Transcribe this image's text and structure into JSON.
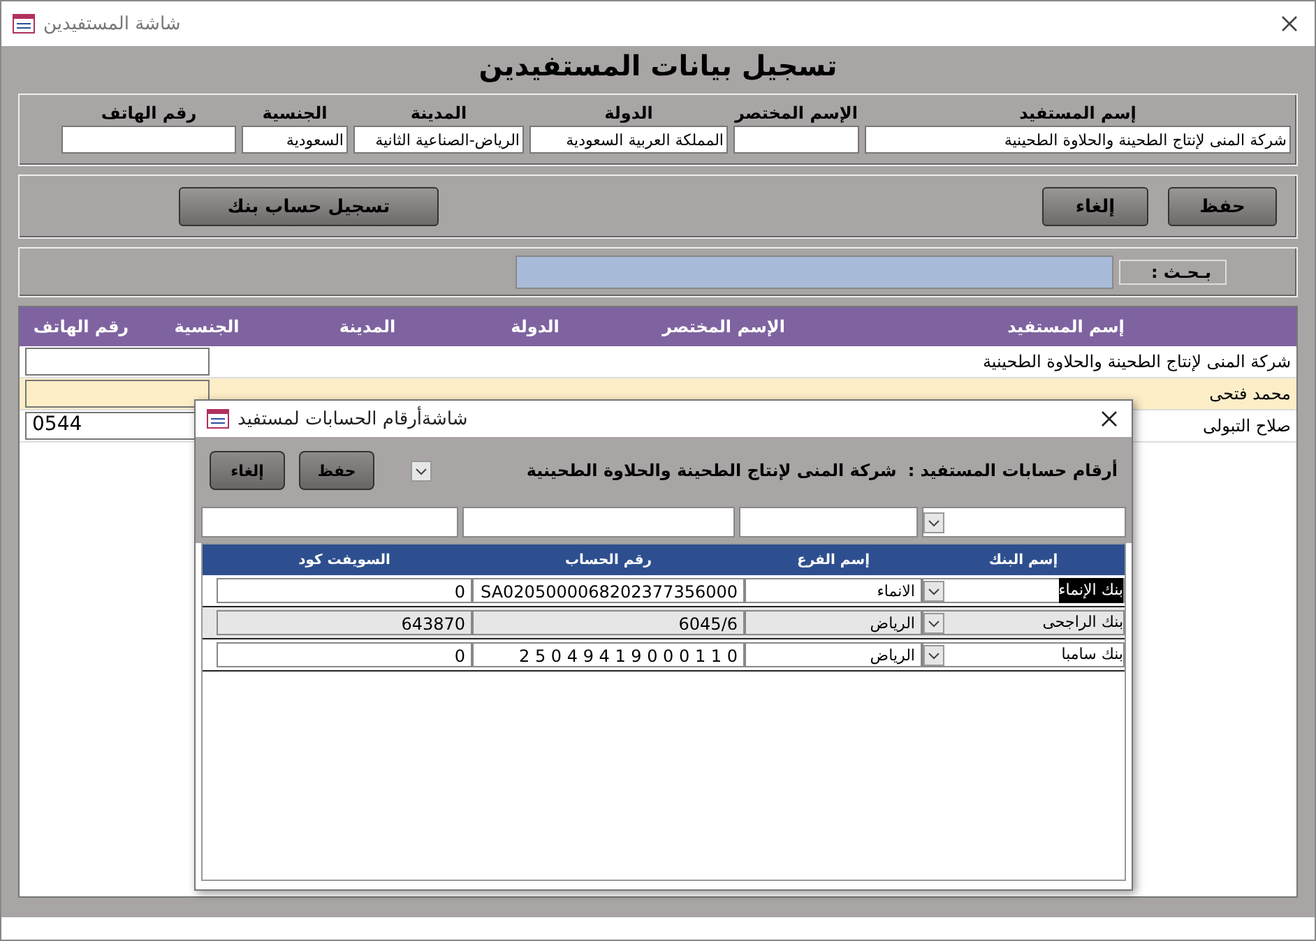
{
  "window": {
    "title": "شاشة المستفيدين"
  },
  "heading": "تسجيل بيانات المستفيدين",
  "form_fields": [
    {
      "label": "إسم المستفيد",
      "value": "شركة المنى لإنتاج الطحينة والحلاوة الطحينية"
    },
    {
      "label": "الإسم المختصر"
    },
    {
      "label": "الدولة",
      "value": "المملكة العربية السعودية"
    },
    {
      "label": "المدينة",
      "value": "الرياض-الصناعية الثانية"
    },
    {
      "label": "الجنسية",
      "value": "السعودية"
    },
    {
      "label": "رقم الهاتف"
    }
  ],
  "buttons": [
    "حفظ",
    "إلغاء",
    "تسجيل حساب بنك"
  ],
  "search": {
    "label": "بـحـث :"
  },
  "table": {
    "columns": [
      "إسم المستفيد",
      "الإسم المختصر",
      "الدولة",
      "المدينة",
      "الجنسية",
      "رقم الهاتف"
    ],
    "rows": [
      {
        "name": "شركة المنى لإنتاج الطحينة والحلاوة الطحينية",
        "selected": false
      },
      {
        "name": "محمد فتحى",
        "selected": true
      },
      {
        "name": "صلاح التبولى",
        "phone": "0544",
        "selected": false
      }
    ]
  },
  "dialog": {
    "title": "شاشةأرقام الحسابات لمستفيد",
    "label": "أرقام حسابات المستفيد :",
    "beneficiary": "شركة المنى لإنتاج الطحينة والحلاوة الطحينية",
    "buttons": [
      "حفظ",
      "إلغاء"
    ],
    "columns": [
      "إسم البنك",
      "إسم الفرع",
      "رقم الحساب",
      "السويفت كود"
    ],
    "rows": [
      {
        "bank": "بنك الإنماء",
        "branch": "الانماء",
        "account": "SA0205000068202377356000",
        "swift": "0",
        "focused": true,
        "selected": false
      },
      {
        "bank": "بنك الراجحى",
        "branch": "الرياض",
        "account": "6045/6",
        "swift": "643870",
        "focused": false,
        "selected": true
      },
      {
        "bank": "بنك سامبا",
        "branch": "الرياض",
        "account": "2 5 0 4 9 4 1 9 0 0 0 1 1 0",
        "swift": "0",
        "focused": false,
        "selected": false
      }
    ]
  }
}
